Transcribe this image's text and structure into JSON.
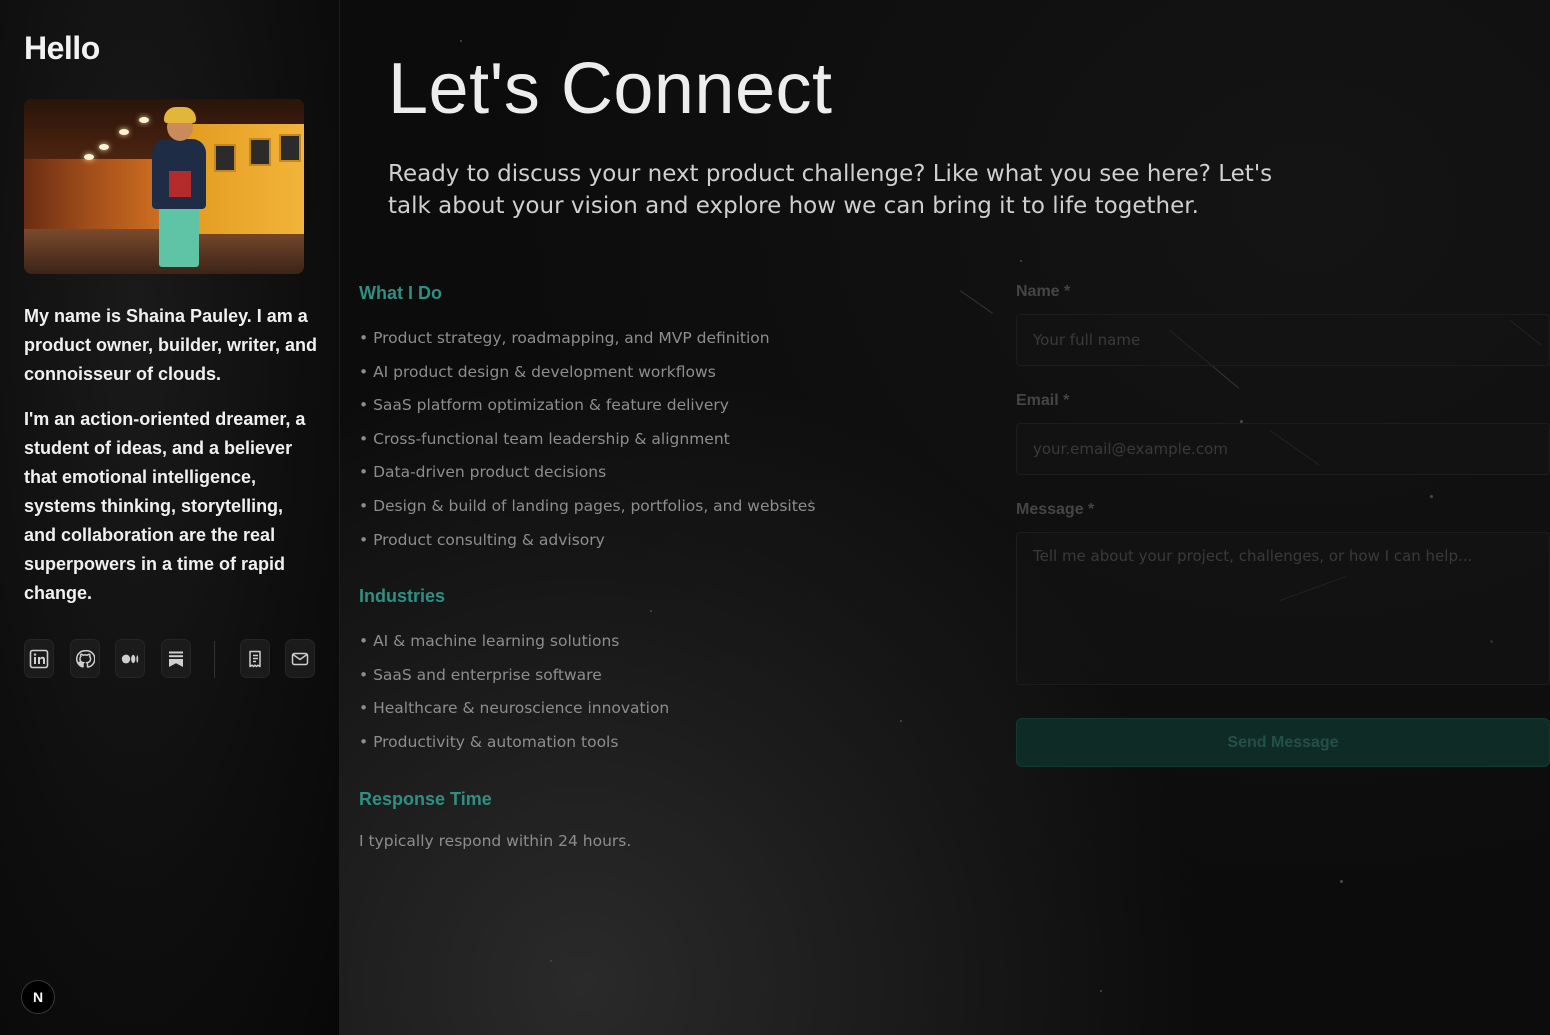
{
  "sidebar": {
    "title": "Hello",
    "bio_1": "My name is Shaina Pauley. I am a product owner, builder, writer, and connoisseur of clouds.",
    "bio_2": "I'm an action-oriented dreamer, a student of ideas, and a believer that emotional intelligence, systems thinking, storytelling, and collaboration are the real superpowers in a time of rapid change.",
    "social_icons": [
      "linkedin-icon",
      "github-icon",
      "medium-icon",
      "substack-icon",
      "resume-icon",
      "mail-icon"
    ],
    "badge": "N"
  },
  "main": {
    "title": "Let's Connect",
    "intro": "Ready to discuss your next product challenge? Like what you see here? Let's talk about your vision and explore how we can bring it to life together.",
    "what_i_do": {
      "heading": "What I Do",
      "items": [
        "Product strategy, roadmapping, and MVP definition",
        "AI product design & development workflows",
        "SaaS platform optimization & feature delivery",
        "Cross-functional team leadership & alignment",
        "Data-driven product decisions",
        "Design & build of landing pages, portfolios, and websites",
        "Product consulting & advisory"
      ]
    },
    "industries": {
      "heading": "Industries",
      "items": [
        "AI & machine learning solutions",
        "SaaS and enterprise software",
        "Healthcare & neuroscience innovation",
        "Productivity & automation tools"
      ]
    },
    "response": {
      "heading": "Response Time",
      "text": "I typically respond within 24 hours."
    }
  },
  "form": {
    "name_label": "Name *",
    "name_placeholder": "Your full name",
    "email_label": "Email *",
    "email_placeholder": "your.email@example.com",
    "message_label": "Message *",
    "message_placeholder": "Tell me about your project, challenges, or how I can help...",
    "submit_label": "Send Message"
  },
  "colors": {
    "accent": "#2f8f83",
    "button_bg": "#0e2b26",
    "background": "#0b0b0b"
  }
}
